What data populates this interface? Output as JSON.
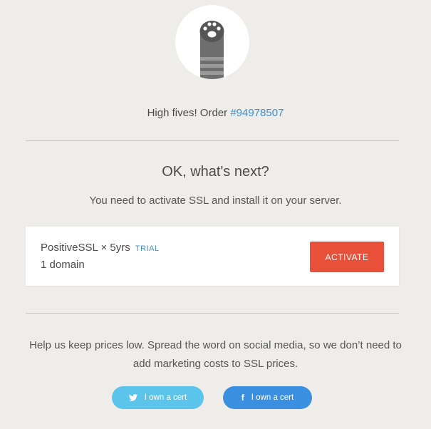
{
  "order": {
    "prefix": "High fives! Order ",
    "number": "#94978507"
  },
  "next": {
    "title": "OK, what's next?",
    "subtitle": "You need to activate SSL and install it on your server."
  },
  "product": {
    "name": "PositiveSSL × 5yrs",
    "badge": "TRIAL",
    "domains": "1 domain",
    "activate_label": "ACTIVATE"
  },
  "share": {
    "message": "Help us keep prices low. Spread the word on social media, so we don’t need to add marketing costs to SSL prices.",
    "twitter_label": "I own a cert",
    "twitter_icon": "twitter-icon",
    "facebook_label": "I own a cert",
    "facebook_icon": "facebook-icon"
  },
  "colors": {
    "background": "#efede9",
    "link": "#3d8fd0",
    "activate": "#e8503a",
    "twitter": "#5bc4ea",
    "facebook": "#3b8fe0"
  }
}
